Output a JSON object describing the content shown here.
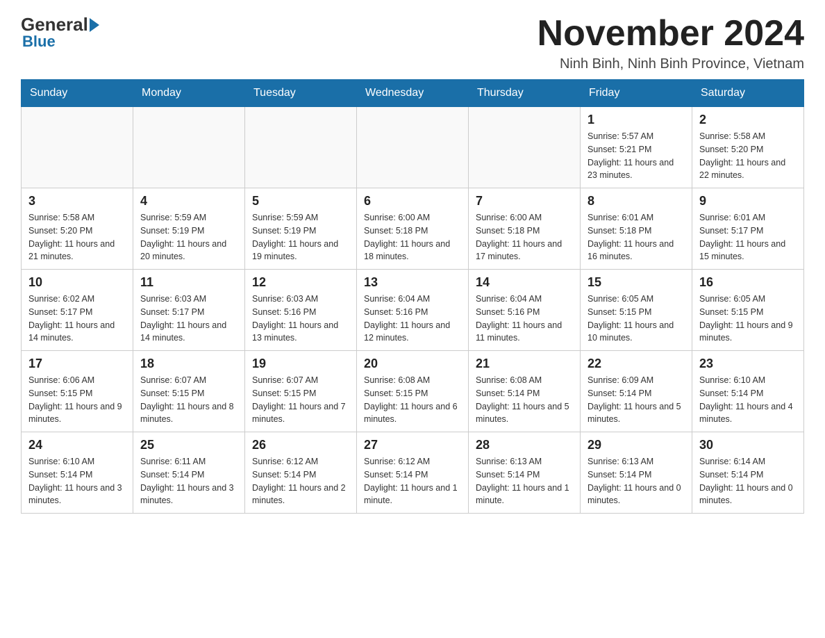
{
  "logo": {
    "text_general": "General",
    "text_blue": "Blue"
  },
  "header": {
    "month_year": "November 2024",
    "location": "Ninh Binh, Ninh Binh Province, Vietnam"
  },
  "weekdays": [
    "Sunday",
    "Monday",
    "Tuesday",
    "Wednesday",
    "Thursday",
    "Friday",
    "Saturday"
  ],
  "weeks": [
    {
      "days": [
        {
          "number": "",
          "info": ""
        },
        {
          "number": "",
          "info": ""
        },
        {
          "number": "",
          "info": ""
        },
        {
          "number": "",
          "info": ""
        },
        {
          "number": "",
          "info": ""
        },
        {
          "number": "1",
          "info": "Sunrise: 5:57 AM\nSunset: 5:21 PM\nDaylight: 11 hours and 23 minutes."
        },
        {
          "number": "2",
          "info": "Sunrise: 5:58 AM\nSunset: 5:20 PM\nDaylight: 11 hours and 22 minutes."
        }
      ]
    },
    {
      "days": [
        {
          "number": "3",
          "info": "Sunrise: 5:58 AM\nSunset: 5:20 PM\nDaylight: 11 hours and 21 minutes."
        },
        {
          "number": "4",
          "info": "Sunrise: 5:59 AM\nSunset: 5:19 PM\nDaylight: 11 hours and 20 minutes."
        },
        {
          "number": "5",
          "info": "Sunrise: 5:59 AM\nSunset: 5:19 PM\nDaylight: 11 hours and 19 minutes."
        },
        {
          "number": "6",
          "info": "Sunrise: 6:00 AM\nSunset: 5:18 PM\nDaylight: 11 hours and 18 minutes."
        },
        {
          "number": "7",
          "info": "Sunrise: 6:00 AM\nSunset: 5:18 PM\nDaylight: 11 hours and 17 minutes."
        },
        {
          "number": "8",
          "info": "Sunrise: 6:01 AM\nSunset: 5:18 PM\nDaylight: 11 hours and 16 minutes."
        },
        {
          "number": "9",
          "info": "Sunrise: 6:01 AM\nSunset: 5:17 PM\nDaylight: 11 hours and 15 minutes."
        }
      ]
    },
    {
      "days": [
        {
          "number": "10",
          "info": "Sunrise: 6:02 AM\nSunset: 5:17 PM\nDaylight: 11 hours and 14 minutes."
        },
        {
          "number": "11",
          "info": "Sunrise: 6:03 AM\nSunset: 5:17 PM\nDaylight: 11 hours and 14 minutes."
        },
        {
          "number": "12",
          "info": "Sunrise: 6:03 AM\nSunset: 5:16 PM\nDaylight: 11 hours and 13 minutes."
        },
        {
          "number": "13",
          "info": "Sunrise: 6:04 AM\nSunset: 5:16 PM\nDaylight: 11 hours and 12 minutes."
        },
        {
          "number": "14",
          "info": "Sunrise: 6:04 AM\nSunset: 5:16 PM\nDaylight: 11 hours and 11 minutes."
        },
        {
          "number": "15",
          "info": "Sunrise: 6:05 AM\nSunset: 5:15 PM\nDaylight: 11 hours and 10 minutes."
        },
        {
          "number": "16",
          "info": "Sunrise: 6:05 AM\nSunset: 5:15 PM\nDaylight: 11 hours and 9 minutes."
        }
      ]
    },
    {
      "days": [
        {
          "number": "17",
          "info": "Sunrise: 6:06 AM\nSunset: 5:15 PM\nDaylight: 11 hours and 9 minutes."
        },
        {
          "number": "18",
          "info": "Sunrise: 6:07 AM\nSunset: 5:15 PM\nDaylight: 11 hours and 8 minutes."
        },
        {
          "number": "19",
          "info": "Sunrise: 6:07 AM\nSunset: 5:15 PM\nDaylight: 11 hours and 7 minutes."
        },
        {
          "number": "20",
          "info": "Sunrise: 6:08 AM\nSunset: 5:15 PM\nDaylight: 11 hours and 6 minutes."
        },
        {
          "number": "21",
          "info": "Sunrise: 6:08 AM\nSunset: 5:14 PM\nDaylight: 11 hours and 5 minutes."
        },
        {
          "number": "22",
          "info": "Sunrise: 6:09 AM\nSunset: 5:14 PM\nDaylight: 11 hours and 5 minutes."
        },
        {
          "number": "23",
          "info": "Sunrise: 6:10 AM\nSunset: 5:14 PM\nDaylight: 11 hours and 4 minutes."
        }
      ]
    },
    {
      "days": [
        {
          "number": "24",
          "info": "Sunrise: 6:10 AM\nSunset: 5:14 PM\nDaylight: 11 hours and 3 minutes."
        },
        {
          "number": "25",
          "info": "Sunrise: 6:11 AM\nSunset: 5:14 PM\nDaylight: 11 hours and 3 minutes."
        },
        {
          "number": "26",
          "info": "Sunrise: 6:12 AM\nSunset: 5:14 PM\nDaylight: 11 hours and 2 minutes."
        },
        {
          "number": "27",
          "info": "Sunrise: 6:12 AM\nSunset: 5:14 PM\nDaylight: 11 hours and 1 minute."
        },
        {
          "number": "28",
          "info": "Sunrise: 6:13 AM\nSunset: 5:14 PM\nDaylight: 11 hours and 1 minute."
        },
        {
          "number": "29",
          "info": "Sunrise: 6:13 AM\nSunset: 5:14 PM\nDaylight: 11 hours and 0 minutes."
        },
        {
          "number": "30",
          "info": "Sunrise: 6:14 AM\nSunset: 5:14 PM\nDaylight: 11 hours and 0 minutes."
        }
      ]
    }
  ]
}
